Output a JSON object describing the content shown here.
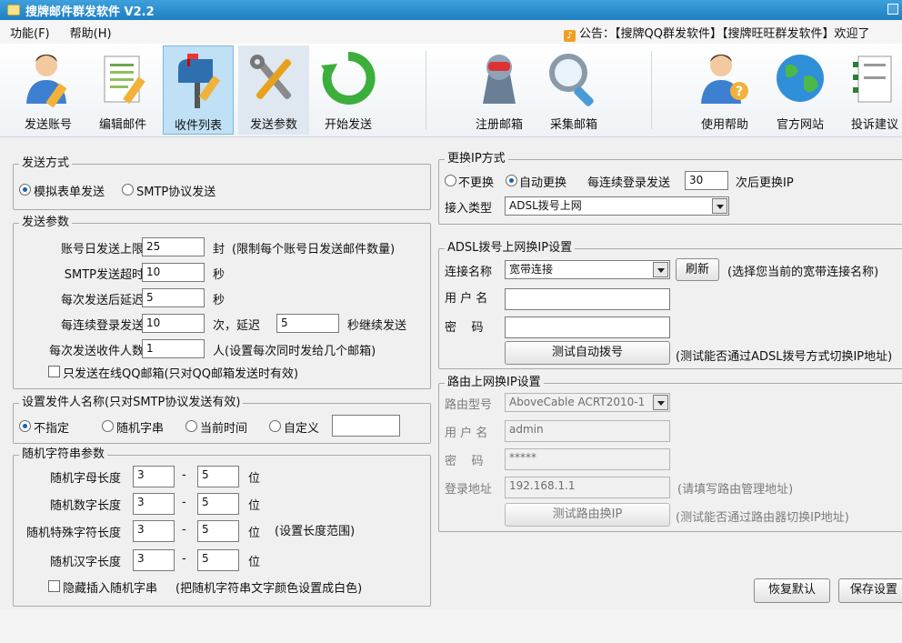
{
  "title": "搜牌邮件群发软件   V2.2",
  "menu": [
    "功能(F)",
    "帮助(H)"
  ],
  "notice": "公告：【搜牌QQ群发软件】【搜牌旺旺群发软件】欢迎了",
  "toolbar": {
    "send_account": "发送账号",
    "edit_mail": "编辑邮件",
    "recipient_list": "收件列表",
    "send_params": "发送参数",
    "start_send": "开始发送",
    "register_mailbox": "注册邮箱",
    "collect_mailbox": "采集邮箱",
    "help": "使用帮助",
    "website": "官方网站",
    "complaint": "投诉建议"
  },
  "send_mode": {
    "title": "发送方式",
    "options": [
      "模拟表单发送",
      "SMTP协议发送"
    ],
    "selected": "模拟表单发送"
  },
  "send_params": {
    "title": "发送参数",
    "daily_limit_label": "账号日发送上限",
    "daily_limit_value": "25",
    "daily_limit_unit": "封",
    "daily_limit_note": "(限制每个账号日发送邮件数量)",
    "smtp_timeout_label": "SMTP发送超时",
    "smtp_timeout_value": "10",
    "smtp_timeout_unit": "秒",
    "delay_label": "每次发送后延迟",
    "delay_value": "5",
    "delay_unit": "秒",
    "login_send_label": "每连续登录发送",
    "login_send_value": "10",
    "login_send_mid": "次，延迟",
    "login_send_delay": "5",
    "login_send_suffix": "秒继续发送",
    "recipients_label": "每次发送收件人数",
    "recipients_value": "1",
    "recipients_note": "人(设置每次同时发给几个邮箱)",
    "online_qq_label": "只发送在线QQ邮箱(只对QQ邮箱发送时有效)"
  },
  "sender_name": {
    "title": "设置发件人名称(只对SMTP协议发送有效)",
    "options": [
      "不指定",
      "随机字串",
      "当前时间",
      "自定义"
    ],
    "selected": "不指定",
    "custom_value": ""
  },
  "random_params": {
    "title": "随机字符串参数",
    "rows": [
      {
        "label": "随机字母长度",
        "min": "3",
        "max": "5",
        "unit": "位",
        "note": ""
      },
      {
        "label": "随机数字长度",
        "min": "3",
        "max": "5",
        "unit": "位",
        "note": ""
      },
      {
        "label": "随机特殊字符长度",
        "min": "3",
        "max": "5",
        "unit": "位",
        "note": "(设置长度范围)"
      },
      {
        "label": "随机汉字长度",
        "min": "3",
        "max": "5",
        "unit": "位",
        "note": ""
      }
    ],
    "dash": "-",
    "hide_label": "隐藏插入随机字串",
    "hide_note": "(把随机字符串文字颜色设置成白色)"
  },
  "ip_change": {
    "title": "更换IP方式",
    "options": [
      "不更换",
      "自动更换"
    ],
    "selected": "自动更换",
    "every_label": "每连续登录发送",
    "every_value": "30",
    "every_suffix": "次后更换IP",
    "access_label": "接入类型",
    "access_value": "ADSL拨号上网"
  },
  "adsl": {
    "title": "ADSL拨号上网换IP设置",
    "conn_label": "连接名称",
    "conn_value": "宽带连接",
    "refresh": "刷新",
    "conn_note": "(选择您当前的宽带连接名称)",
    "user_label": "用 户 名",
    "user_value": "",
    "pass_label": "密    码",
    "pass_value": "",
    "test_button": "测试自动拨号",
    "test_note": "(测试能否通过ADSL拨号方式切换IP地址)"
  },
  "router": {
    "title": "路由上网换IP设置",
    "model_label": "路由型号",
    "model_value": "AboveCable  ACRT2010-1",
    "user_label": "用 户 名",
    "user_value": "admin",
    "pass_label": "密    码",
    "pass_value": "*****",
    "addr_label": "登录地址",
    "addr_value": "192.168.1.1",
    "addr_note": "(请填写路由管理地址)",
    "test_button": "测试路由换IP",
    "test_note": "(测试能否通过路由器切换IP地址)"
  },
  "actions": {
    "restore": "恢复默认",
    "save": "保存设置"
  }
}
